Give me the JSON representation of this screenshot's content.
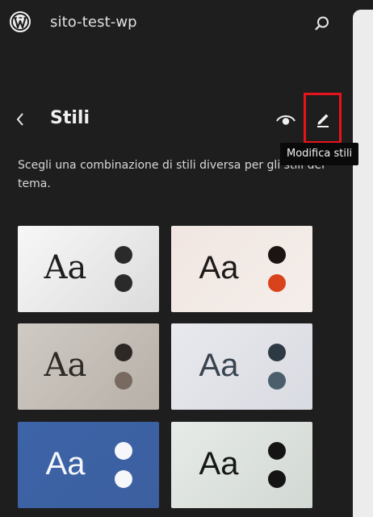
{
  "site": {
    "title": "sito-test-wp"
  },
  "panel": {
    "title": "Stili",
    "tooltip": "Modifica stili",
    "description": "Scegli una combinazione di stili diversa per gli stili del tema."
  },
  "icons": {
    "logo": "wordpress-icon",
    "search": "search-icon",
    "back": "chevron-left-icon",
    "preview": "eye-icon",
    "edit": "pencil-icon"
  },
  "colors": {
    "sidebar_bg": "#1e1e1e",
    "highlight_border": "#e8141b",
    "tooltip_bg": "#0a0a0a"
  },
  "styles": [
    {
      "label": "Aa",
      "font": "serif",
      "text_color": "#1e1e1e",
      "bg": "linear-gradient(135deg,#f7f7f7 0%,#dcdcdc 100%)",
      "dot1": "#2a2a2a",
      "dot2": "#2a2a2a"
    },
    {
      "label": "Aa",
      "font": "sans",
      "text_color": "#1d1a19",
      "bg": "linear-gradient(135deg,#f1e6e1 0%,#f4eeea 100%)",
      "dot1": "#1b1412",
      "dot2": "#d8431b"
    },
    {
      "label": "Aa",
      "font": "serif",
      "text_color": "#2e2a26",
      "bg": "linear-gradient(135deg,#cfcac4 0%,#b7b0a8 100%)",
      "dot1": "#2d2826",
      "dot2": "#786a60"
    },
    {
      "label": "Aa",
      "font": "sans",
      "text_color": "#37434f",
      "bg": "linear-gradient(135deg,#e8e9ee 0%,#d9dbe2 100%)",
      "dot1": "#2d3a44",
      "dot2": "#4b5e6b"
    },
    {
      "label": "Aa",
      "font": "sans",
      "text_color": "#f5f7fb",
      "bg": "linear-gradient(135deg,#3d64a8 0%,#3c5f9f 100%)",
      "dot1": "#f5f7fb",
      "dot2": "#f5f7fb"
    },
    {
      "label": "Aa",
      "font": "sans",
      "text_color": "#161616",
      "bg": "linear-gradient(135deg,#e6ebe7 0%,#d2d8d3 100%)",
      "dot1": "#141414",
      "dot2": "#141414"
    }
  ]
}
